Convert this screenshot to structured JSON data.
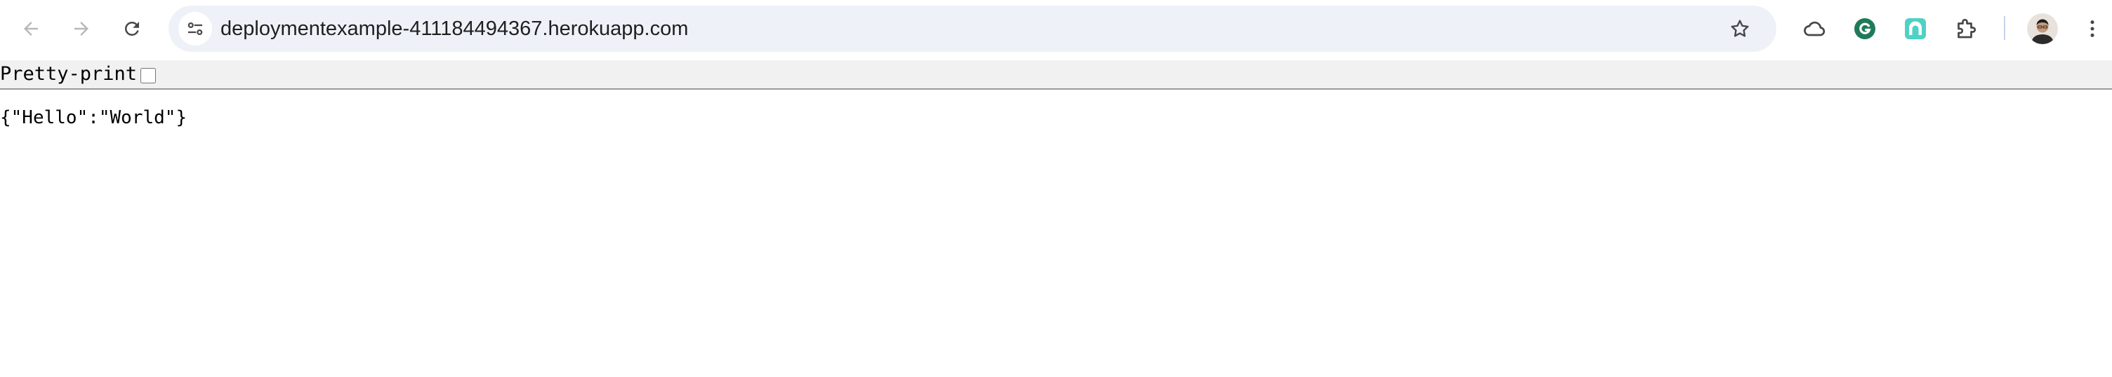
{
  "browser": {
    "url": "deploymentexample-411184494367.herokuapp.com",
    "icons": {
      "back": "back-arrow-icon",
      "forward": "forward-arrow-icon",
      "reload": "reload-icon",
      "site_info": "site-settings-icon",
      "bookmark": "star-icon",
      "cloud": "cloud-icon",
      "grammarly": "grammarly-icon",
      "teal_extension": "teal-extension-icon",
      "extensions": "puzzle-icon",
      "profile": "avatar",
      "menu": "kebab-menu-icon"
    },
    "colors": {
      "omnibox_bg": "#eef1f8",
      "grammarly": "#15c39a",
      "teal_extension": "#4fd1c5"
    }
  },
  "viewer": {
    "pretty_print_label": "Pretty-print",
    "pretty_print_checked": false,
    "content": "{\"Hello\":\"World\"}"
  }
}
